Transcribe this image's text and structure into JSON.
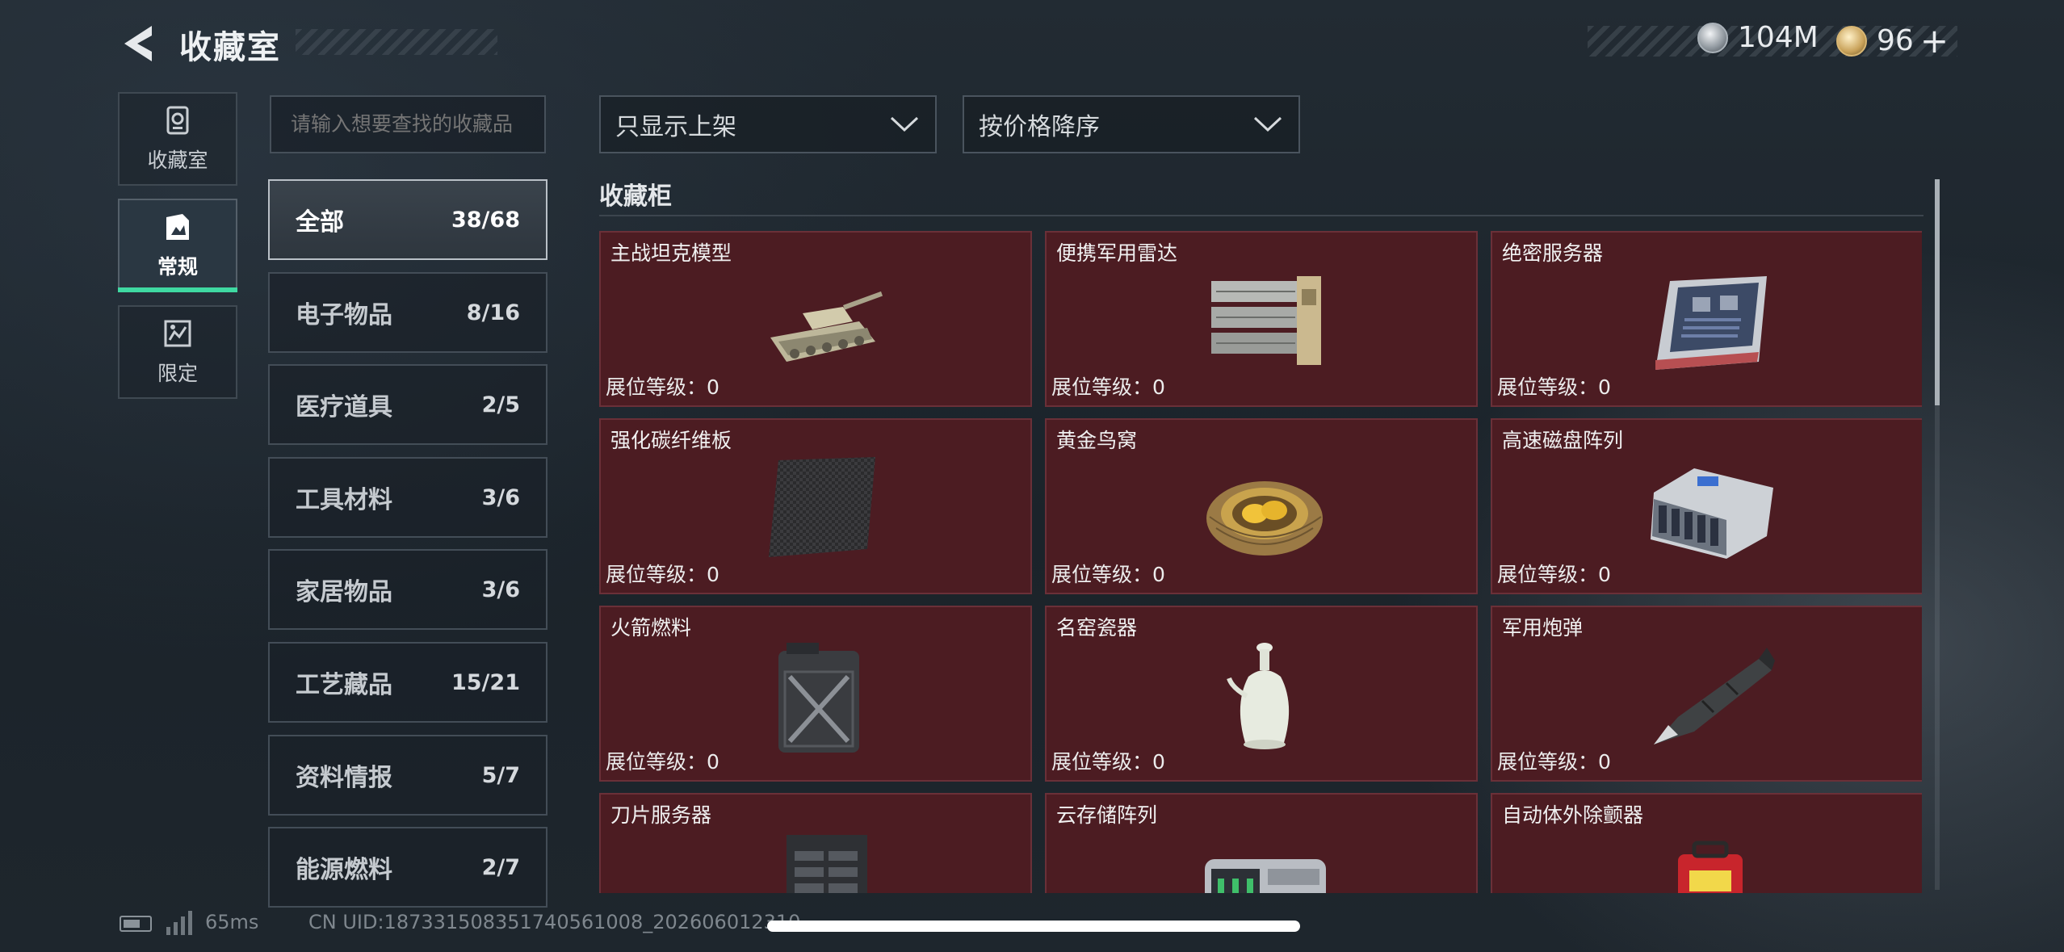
{
  "header": {
    "title": "收藏室",
    "currency_silver": "104M",
    "currency_gold": "96",
    "plus": "+"
  },
  "sidebar": {
    "items": [
      {
        "label": "收藏室",
        "icon": "collection-room-icon",
        "active": false
      },
      {
        "label": "常规",
        "icon": "regular-icon",
        "active": true
      },
      {
        "label": "限定",
        "icon": "limited-icon",
        "active": false
      }
    ]
  },
  "search": {
    "placeholder": "请输入想要查找的收藏品"
  },
  "categories": [
    {
      "label": "全部",
      "count": "38/68",
      "active": true
    },
    {
      "label": "电子物品",
      "count": "8/16"
    },
    {
      "label": "医疗道具",
      "count": "2/5"
    },
    {
      "label": "工具材料",
      "count": "3/6"
    },
    {
      "label": "家居物品",
      "count": "3/6"
    },
    {
      "label": "工艺藏品",
      "count": "15/21"
    },
    {
      "label": "资料情报",
      "count": "5/7"
    },
    {
      "label": "能源燃料",
      "count": "2/7"
    }
  ],
  "filters": {
    "shelf_filter": "只显示上架",
    "sort_order": "按价格降序"
  },
  "cabinet": {
    "title": "收藏柜",
    "level_label": "展位等级：",
    "items": [
      {
        "name": "主战坦克模型",
        "level": "0",
        "icon": "tank-model-icon"
      },
      {
        "name": "便携军用雷达",
        "level": "0",
        "icon": "radar-icon"
      },
      {
        "name": "绝密服务器",
        "level": "0",
        "icon": "server-icon"
      },
      {
        "name": "强化碳纤维板",
        "level": "0",
        "icon": "carbon-plate-icon"
      },
      {
        "name": "黄金鸟窝",
        "level": "0",
        "icon": "golden-nest-icon"
      },
      {
        "name": "高速磁盘阵列",
        "level": "0",
        "icon": "disk-array-icon"
      },
      {
        "name": "火箭燃料",
        "level": "0",
        "icon": "fuel-can-icon"
      },
      {
        "name": "名窑瓷器",
        "level": "0",
        "icon": "porcelain-vase-icon"
      },
      {
        "name": "军用炮弹",
        "level": "0",
        "icon": "artillery-shell-icon"
      },
      {
        "name": "刀片服务器",
        "level": "",
        "icon": "blade-server-icon"
      },
      {
        "name": "云存储阵列",
        "level": "",
        "icon": "cloud-storage-icon"
      },
      {
        "name": "自动体外除颤器",
        "level": "",
        "icon": "defibrillator-icon"
      }
    ]
  },
  "status": {
    "ping": "65ms",
    "uid": "CN UID:1873315083517405610​08_202606012310"
  },
  "colors": {
    "card_bg": "#4c1c22",
    "accent_green": "#3fd9a2"
  }
}
